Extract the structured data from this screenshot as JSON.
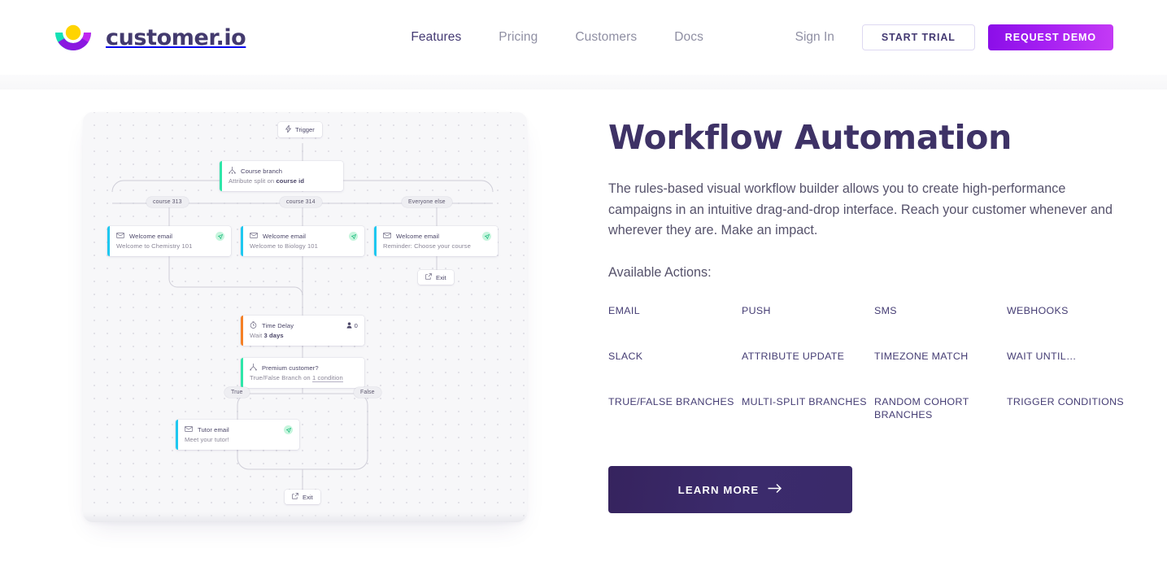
{
  "header": {
    "logo_text": "customer.io",
    "logo_icon": "customerio-logo-icon",
    "nav": [
      {
        "label": "Features",
        "active": true
      },
      {
        "label": "Pricing",
        "active": false
      },
      {
        "label": "Customers",
        "active": false
      },
      {
        "label": "Docs",
        "active": false
      }
    ],
    "signin_label": "Sign In",
    "start_trial_label": "START TRIAL",
    "request_demo_label": "REQUEST DEMO"
  },
  "hero": {
    "headline": "Workflow Automation",
    "paragraph": "The rules-based visual workflow builder allows you to create high-performance campaigns in an intuitive drag-and-drop interface. Reach your customer whenever and wherever they are. Make an impact.",
    "available_label": "Available Actions:",
    "actions": [
      "EMAIL",
      "PUSH",
      "SMS",
      "WEBHOOKS",
      "SLACK",
      "ATTRIBUTE UPDATE",
      "TIMEZONE MATCH",
      "WAIT UNTIL…",
      "TRUE/FALSE BRANCHES",
      "MULTI-SPLIT BRANCHES",
      "RANDOM COHORT BRANCHES",
      "TRIGGER CONDITIONS"
    ],
    "cta_label": "LEARN MORE",
    "cta_icon": "arrow-right-icon"
  },
  "workflow": {
    "trigger": {
      "title": "Trigger",
      "icon": "lightning-icon"
    },
    "course_branch": {
      "title": "Course branch",
      "subtitle_prefix": "Attribute split on ",
      "subtitle_bold": "course id",
      "icon": "split-icon",
      "accent": "#2ee6a8"
    },
    "branch_pills": [
      "course 313",
      "course 314",
      "Everyone else"
    ],
    "emails": [
      {
        "title": "Welcome email",
        "subtitle": "Welcome to Chemistry 101",
        "icon": "envelope-icon",
        "badge": "paper-plane-icon",
        "accent": "#1ec8f0"
      },
      {
        "title": "Welcome email",
        "subtitle": "Welcome to Biology 101",
        "icon": "envelope-icon",
        "badge": "paper-plane-icon",
        "accent": "#1ec8f0"
      },
      {
        "title": "Welcome email",
        "subtitle": "Reminder: Choose your course",
        "icon": "envelope-icon",
        "badge": "paper-plane-icon",
        "accent": "#1ec8f0"
      }
    ],
    "exit_top": {
      "label": "Exit",
      "icon": "exit-icon"
    },
    "time_delay": {
      "title": "Time Delay",
      "subtitle_prefix": "Wait ",
      "subtitle_bold": "3 days",
      "icon": "clock-icon",
      "count_icon": "person-icon",
      "count": "0",
      "accent": "#f58025"
    },
    "premium": {
      "title": "Premium customer?",
      "subtitle_prefix": "True/False Branch on ",
      "subtitle_link": "1 condition",
      "icon": "split-icon",
      "accent": "#2ee6a8"
    },
    "tf_pills": [
      "True",
      "False"
    ],
    "tutor_email": {
      "title": "Tutor email",
      "subtitle": "Meet your tutor!",
      "icon": "envelope-icon",
      "badge": "paper-plane-icon",
      "accent": "#1ec8f0"
    },
    "exit_bottom": {
      "label": "Exit",
      "icon": "exit-icon"
    }
  },
  "colors": {
    "brand_purple": "#3e3266",
    "accent_magenta": "#a51ff2",
    "logo_yellow": "#ffd400",
    "logo_teal": "#14e1b5",
    "logo_violet": "#8a18e0"
  }
}
